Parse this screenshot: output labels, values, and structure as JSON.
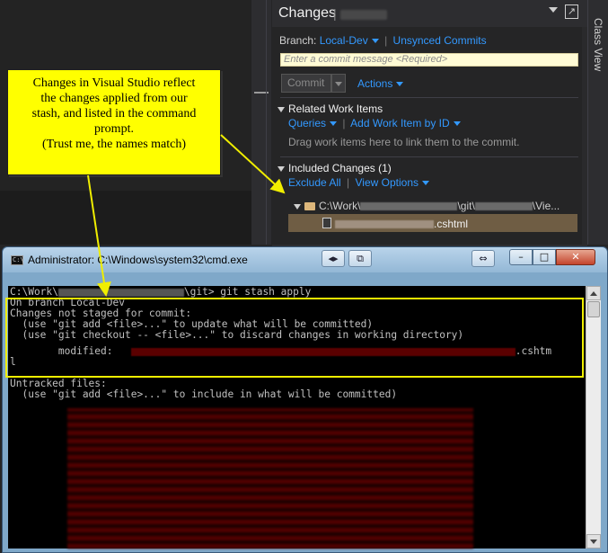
{
  "team_explorer": {
    "title": "Changes",
    "branch_label": "Branch:",
    "branch_name": "Local-Dev",
    "unsynced_link": "Unsynced Commits",
    "commit_placeholder": "Enter a commit message <Required>",
    "commit_button": "Commit",
    "actions_link": "Actions",
    "related_header": "Related Work Items",
    "queries_link": "Queries",
    "add_work_item_link": "Add Work Item by ID",
    "drag_hint": "Drag work items here to link them to the commit.",
    "included_header": "Included Changes (1)",
    "exclude_all_link": "Exclude All",
    "view_options_link": "View Options",
    "folder_path_start": "C:\\Work\\",
    "folder_path_mid": "\\git\\",
    "folder_path_end": "\\Vie...",
    "file_ext": ".cshtml"
  },
  "class_view": {
    "label": "Class View"
  },
  "cmd": {
    "title": "Administrator: C:\\Windows\\system32\\cmd.exe",
    "icon_text": "C:\\",
    "line_prompt_start": "C:\\Work\\",
    "line_prompt_end": "\\git> git stash apply",
    "line_branch": "On branch Local-Dev",
    "line_not_staged": "Changes not staged for commit:",
    "line_hint_add": "  (use \"git add <file>...\" to update what will be committed)",
    "line_hint_checkout": "  (use \"git checkout -- <file>...\" to discard changes in working directory)",
    "line_modified_label": "        modified:",
    "line_modified_ext": ".cshtm",
    "line_wrap": "l",
    "line_untracked": "Untracked files:",
    "line_hint_untracked": "  (use \"git add <file>...\" to include in what will be committed)"
  },
  "callout": {
    "line1": "Changes in Visual Studio reflect",
    "line2": "the changes applied from our",
    "line3": "stash, and listed in the command",
    "line4": "prompt.",
    "line5": "(Trust me, the names match)"
  },
  "colors": {
    "vs_bg": "#252526",
    "link": "#3399ff",
    "callout_bg": "#ffff00",
    "highlight_frame": "#f0ee00",
    "console_red": "#c00000"
  }
}
